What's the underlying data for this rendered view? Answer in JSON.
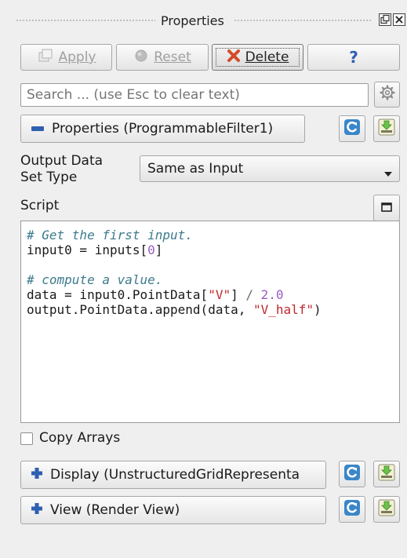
{
  "panel": {
    "title": "Properties"
  },
  "toolbar": {
    "apply_label": "Apply",
    "reset_label": "Reset",
    "delete_label": "Delete",
    "help_label": "?"
  },
  "search": {
    "placeholder": "Search ... (use Esc to clear text)"
  },
  "properties_section": {
    "label": "Properties (ProgrammableFilter1)",
    "icon": "minus-icon"
  },
  "output_type": {
    "label_line1": "Output Data",
    "label_line2": "Set Type",
    "value": "Same as Input"
  },
  "script": {
    "label": "Script",
    "lines": [
      {
        "parts": [
          {
            "t": "# Get the first input.",
            "c": "c-cm"
          }
        ]
      },
      {
        "parts": [
          {
            "t": "input0 = inputs[",
            "c": ""
          },
          {
            "t": "0",
            "c": "c-num"
          },
          {
            "t": "]",
            "c": ""
          }
        ]
      },
      {
        "parts": []
      },
      {
        "parts": [
          {
            "t": "# compute a value.",
            "c": "c-cm"
          }
        ]
      },
      {
        "parts": [
          {
            "t": "data = input0.PointData[",
            "c": ""
          },
          {
            "t": "\"V\"",
            "c": "c-str"
          },
          {
            "t": "] ",
            "c": ""
          },
          {
            "t": "/",
            "c": "c-op"
          },
          {
            "t": " ",
            "c": ""
          },
          {
            "t": "2.0",
            "c": "c-num"
          }
        ]
      },
      {
        "parts": [
          {
            "t": "output.PointData.append(data, ",
            "c": ""
          },
          {
            "t": "\"V_half\"",
            "c": "c-str"
          },
          {
            "t": ")",
            "c": ""
          }
        ]
      }
    ]
  },
  "copy_arrays": {
    "label": "Copy Arrays",
    "checked": false
  },
  "display_section": {
    "label": "Display (UnstructuredGridRepresenta",
    "icon": "plus-icon"
  },
  "view_section": {
    "label": "View (Render View)",
    "icon": "plus-icon"
  },
  "colors": {
    "accent_blue": "#2f5fb0",
    "delete_red": "#d44b2a",
    "comment": "#3b7a8c",
    "string": "#c1272d",
    "number": "#9a5bc2"
  }
}
